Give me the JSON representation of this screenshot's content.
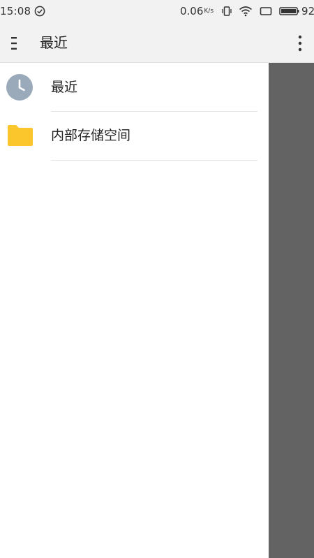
{
  "status_bar": {
    "time": "15:08",
    "speed": "0.06",
    "speed_unit": "K/s",
    "battery": "92"
  },
  "app_bar": {
    "title": "最近",
    "menu_icon": "menu-icon",
    "more_icon": "more-vert-icon"
  },
  "drawer": {
    "items": [
      {
        "label": "最近",
        "icon": "clock-icon"
      },
      {
        "label": "内部存储空间",
        "icon": "folder-icon"
      }
    ]
  },
  "colors": {
    "status_bar_bg": "#f2f2f2",
    "clock_icon": "#9aaabb",
    "folder_icon": "#fbc52c",
    "scrim": "#636363"
  }
}
